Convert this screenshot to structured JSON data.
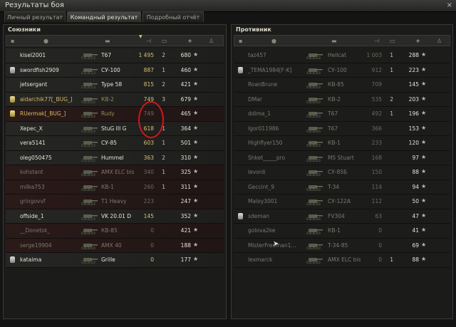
{
  "window": {
    "title": "Результаты боя",
    "close": "×"
  },
  "tabs": [
    {
      "label": "Личный результат",
      "active": false
    },
    {
      "label": "Командный результат",
      "active": true
    },
    {
      "label": "Подробный отчёт",
      "active": false
    }
  ],
  "allies": {
    "title": "Союзники",
    "rows": [
      {
        "state": "alive",
        "medal": "",
        "player": "kisel2001",
        "tank": "T67",
        "dmg": "1 495",
        "frags": "2",
        "xp": "680"
      },
      {
        "state": "alive",
        "medal": "silver",
        "player": "swordfish2909",
        "tank": "СУ-100",
        "dmg": "887",
        "frags": "1",
        "xp": "460"
      },
      {
        "state": "alive",
        "medal": "",
        "player": "jetsergant",
        "tank": "Type 58",
        "dmg": "815",
        "frags": "2",
        "xp": "421"
      },
      {
        "state": "bug",
        "medal": "gold",
        "player": "aidarchik77[_BUG_]",
        "tank": "КВ-2",
        "dmg": "749",
        "frags": "3",
        "xp": "679"
      },
      {
        "state": "bugdead",
        "medal": "gold",
        "player": "RUermak[_BUG_]",
        "tank": "Rudy",
        "dmg": "749",
        "frags": "",
        "xp": "465"
      },
      {
        "state": "alive",
        "medal": "",
        "player": "Xepec_X",
        "tank": "StuG III G",
        "dmg": "618",
        "frags": "1",
        "xp": "364"
      },
      {
        "state": "alive",
        "medal": "",
        "player": "vera5141",
        "tank": "СУ-85",
        "dmg": "603",
        "frags": "1",
        "xp": "501"
      },
      {
        "state": "alive",
        "medal": "",
        "player": "oleg050475",
        "tank": "Hummel",
        "dmg": "363",
        "frags": "2",
        "xp": "310"
      },
      {
        "state": "dead",
        "medal": "",
        "player": "kohstant",
        "tank": "AMX ELC bis",
        "dmg": "340",
        "frags": "1",
        "xp": "325"
      },
      {
        "state": "dead",
        "medal": "",
        "player": "milka753",
        "tank": "КВ-1",
        "dmg": "260",
        "frags": "1",
        "xp": "311"
      },
      {
        "state": "dead",
        "medal": "",
        "player": "gringovvf",
        "tank": "T1 Heavy",
        "dmg": "223",
        "frags": "",
        "xp": "247"
      },
      {
        "state": "alive",
        "medal": "",
        "player": "offside_1",
        "tank": "VK 20.01 D",
        "dmg": "145",
        "frags": "",
        "xp": "352"
      },
      {
        "state": "dead",
        "medal": "",
        "player": "__Donetsk_",
        "tank": "КВ-85",
        "dmg": "0",
        "frags": "",
        "xp": "421"
      },
      {
        "state": "dead",
        "medal": "",
        "player": "serge19904",
        "tank": "AMX 40",
        "dmg": "0",
        "frags": "",
        "xp": "188"
      },
      {
        "state": "alive",
        "medal": "silver",
        "player": "kataima",
        "tank": "Grille",
        "dmg": "0",
        "frags": "",
        "xp": "177"
      }
    ]
  },
  "enemies": {
    "title": "Противник",
    "rows": [
      {
        "state": "deadr",
        "medal": "",
        "player": "taz457",
        "tank": "Hellcat",
        "dmg": "1 003",
        "frags": "1",
        "xp": "288"
      },
      {
        "state": "deadr",
        "medal": "silver",
        "player": "_TEMA1984[F-K]",
        "tank": "СУ-100",
        "dmg": "912",
        "frags": "1",
        "xp": "223"
      },
      {
        "state": "deadr",
        "medal": "",
        "player": "RoanBrune",
        "tank": "КВ-85",
        "dmg": "709",
        "frags": "",
        "xp": "145"
      },
      {
        "state": "deadr",
        "medal": "",
        "player": "DMar",
        "tank": "КВ-2",
        "dmg": "535",
        "frags": "2",
        "xp": "203"
      },
      {
        "state": "deadr",
        "medal": "",
        "player": "ddima_1",
        "tank": "T67",
        "dmg": "492",
        "frags": "1",
        "xp": "196"
      },
      {
        "state": "deadr",
        "medal": "",
        "player": "Igor011986",
        "tank": "T67",
        "dmg": "366",
        "frags": "",
        "xp": "153"
      },
      {
        "state": "deadr",
        "medal": "",
        "player": "Highflyer150",
        "tank": "КВ-1",
        "dmg": "233",
        "frags": "",
        "xp": "120"
      },
      {
        "state": "deadr",
        "medal": "",
        "player": "Shket_____pro",
        "tank": "M5 Stuart",
        "dmg": "168",
        "frags": "",
        "xp": "97"
      },
      {
        "state": "deadr",
        "medal": "",
        "player": "levonli",
        "tank": "СУ-85Б",
        "dmg": "150",
        "frags": "",
        "xp": "88"
      },
      {
        "state": "deadr",
        "medal": "",
        "player": "Geccint_9",
        "tank": "T-34",
        "dmg": "114",
        "frags": "",
        "xp": "94"
      },
      {
        "state": "deadr",
        "medal": "",
        "player": "Maloy3001",
        "tank": "СУ-122А",
        "dmg": "112",
        "frags": "",
        "xp": "50"
      },
      {
        "state": "deadr",
        "medal": "silver",
        "player": "sdeman",
        "tank": "FV304",
        "dmg": "63",
        "frags": "",
        "xp": "47"
      },
      {
        "state": "deadr",
        "medal": "",
        "player": "golova2ke",
        "tank": "КВ-1",
        "dmg": "0",
        "frags": "",
        "xp": "41"
      },
      {
        "state": "deadr",
        "medal": "",
        "player": "MisterFreeman1...",
        "tank": "T-34-85",
        "dmg": "0",
        "frags": "",
        "xp": "69"
      },
      {
        "state": "deadr",
        "medal": "",
        "player": "lexmarck",
        "tank": "AMX ELC bis",
        "dmg": "0",
        "frags": "1",
        "xp": "88"
      }
    ]
  },
  "icons": {
    "star": "★",
    "sort": "▼"
  }
}
